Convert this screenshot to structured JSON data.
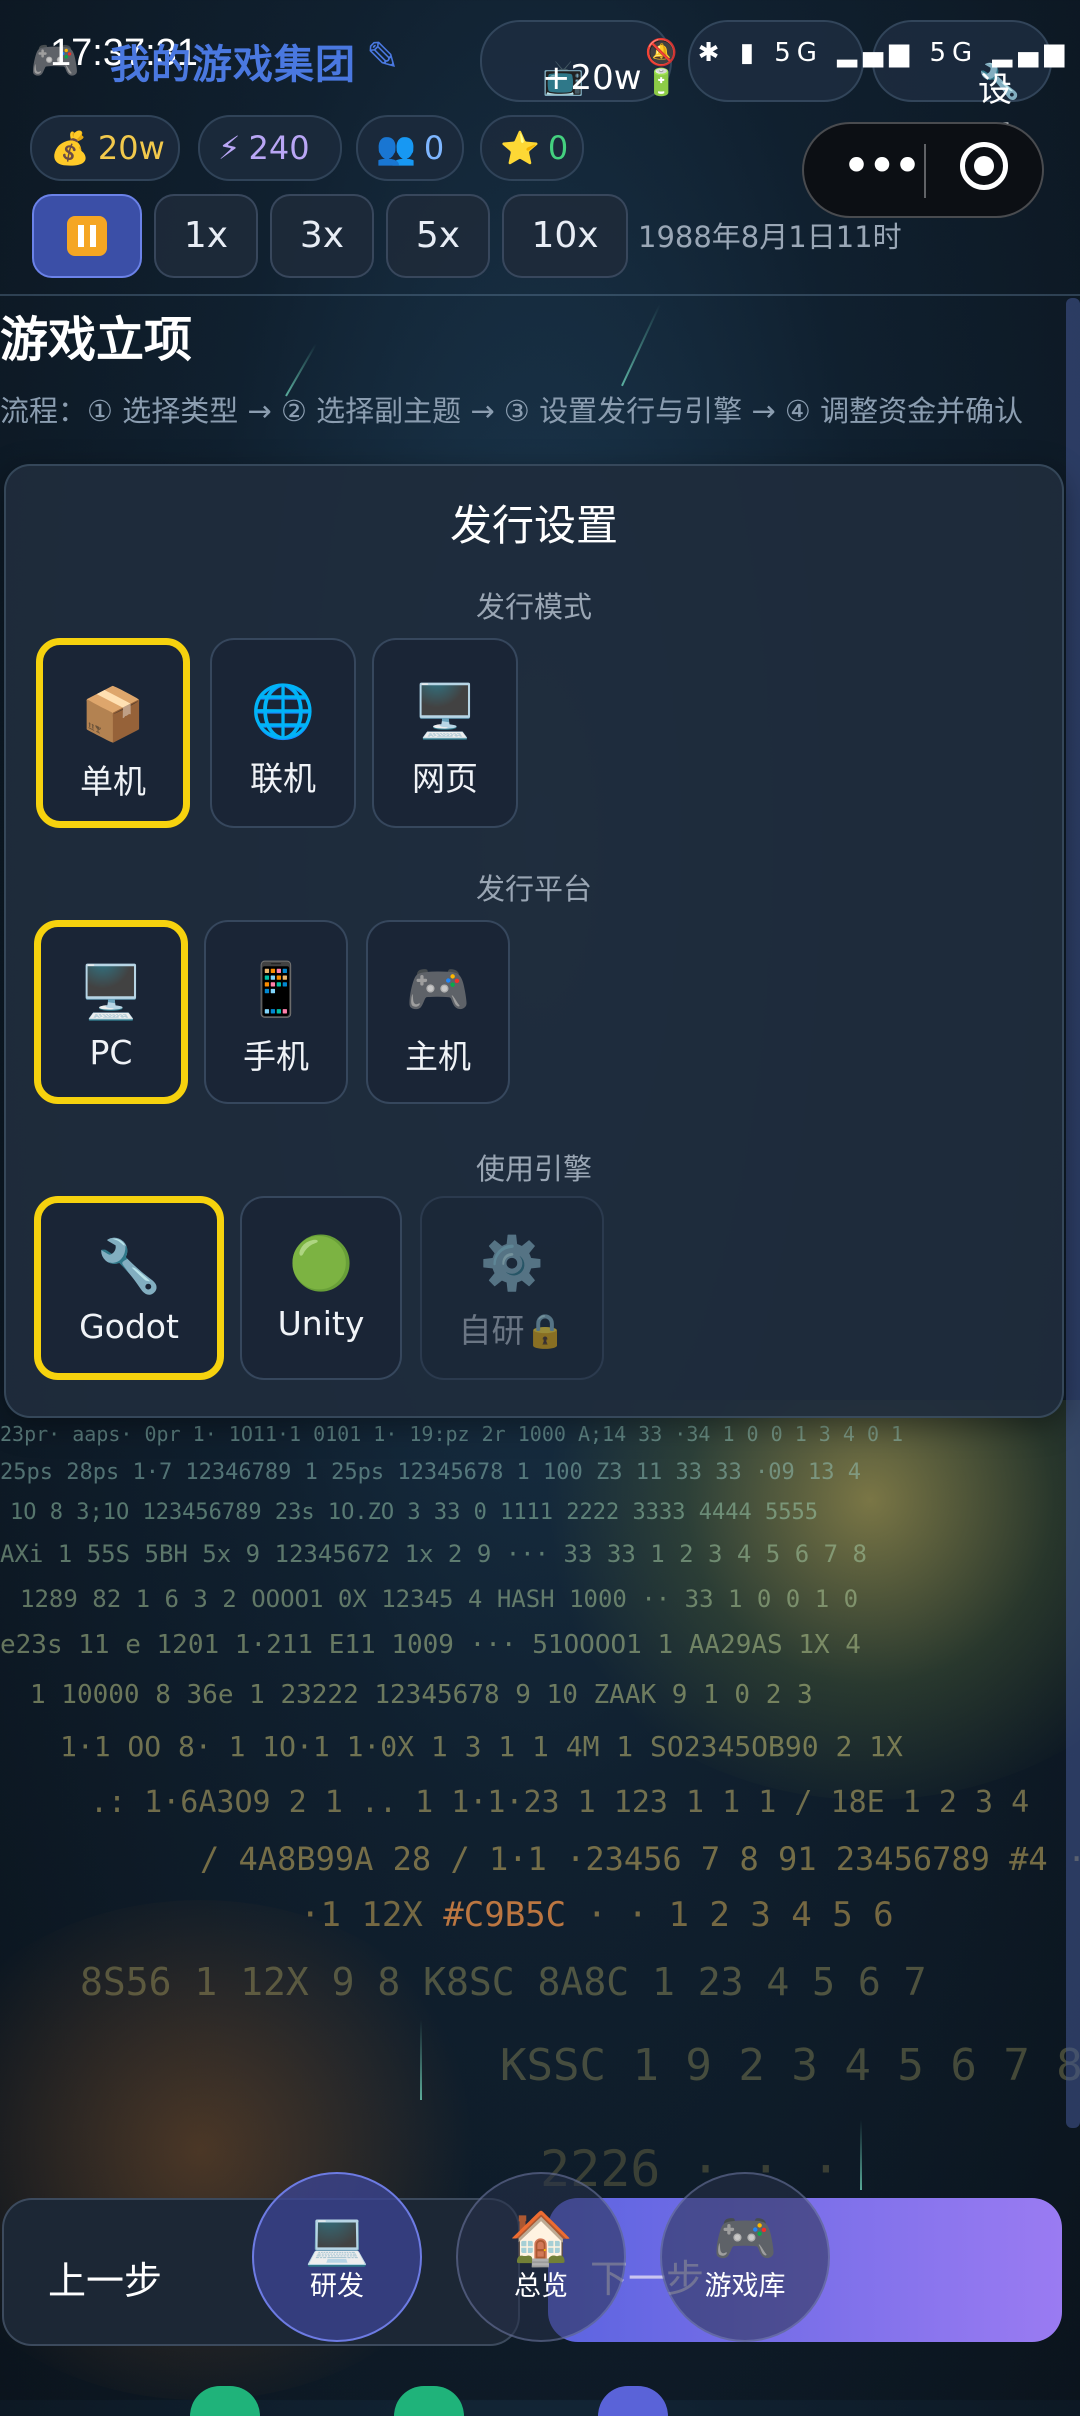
{
  "status_bar": {
    "time": "17:37:31",
    "app_title": "我的游戏集团",
    "tv_label": "+20w",
    "settings_label": "设置"
  },
  "resources": {
    "money": "20w",
    "energy": "240",
    "fans": "0",
    "stars": "0"
  },
  "speed": {
    "options": [
      "1x",
      "3x",
      "5x",
      "10x"
    ],
    "date": "1988年8月1日11时"
  },
  "page": {
    "title": "游戏立项",
    "flow": "流程：① 选择类型 → ② 选择副主题 → ③ 设置发行与引擎 → ④ 调整资金并确认"
  },
  "panel": {
    "title": "发行设置",
    "mode_label": "发行模式",
    "modes": [
      {
        "icon": "📦",
        "label": "单机",
        "selected": true
      },
      {
        "icon": "🌐",
        "label": "联机",
        "selected": false
      },
      {
        "icon": "🖥️",
        "label": "网页",
        "selected": false
      }
    ],
    "platform_label": "发行平台",
    "platforms": [
      {
        "icon": "🖥️",
        "label": "PC",
        "selected": true
      },
      {
        "icon": "📱",
        "label": "手机",
        "selected": false
      },
      {
        "icon": "🎮",
        "label": "主机",
        "selected": false
      }
    ],
    "engine_label": "使用引擎",
    "engines": [
      {
        "icon": "🔧",
        "label": "Godot",
        "selected": true
      },
      {
        "icon": "🟢",
        "label": "Unity",
        "selected": false
      },
      {
        "icon": "⚙️",
        "label": "自研🔒",
        "selected": false,
        "locked": true
      }
    ]
  },
  "bottom": {
    "prev_label": "上一步",
    "next_label": "下一步",
    "nav": [
      {
        "icon": "💻",
        "label": "研发"
      },
      {
        "icon": "🏠",
        "label": "总览"
      },
      {
        "icon": "🎮",
        "label": "游戏库"
      }
    ]
  },
  "colors": {
    "accent": "#f6d20e",
    "brand": "#4a78e0",
    "next_gradient_start": "#5c64e0",
    "next_gradient_end": "#9a7bf2"
  },
  "background_text": [
    "#C9B5C"
  ]
}
